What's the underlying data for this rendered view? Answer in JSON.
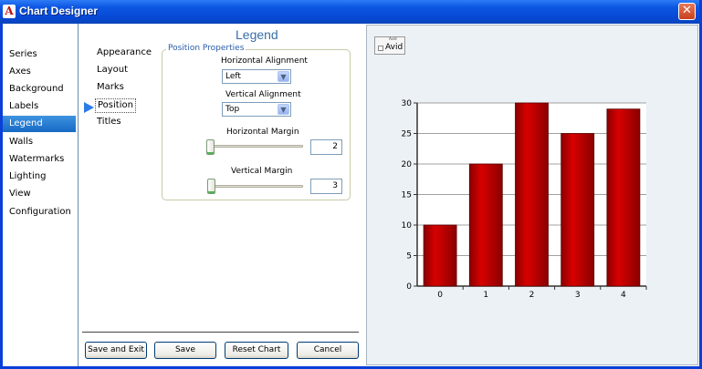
{
  "window": {
    "title": "Chart Designer",
    "app_icon_letter": "A",
    "close_glyph": "✕"
  },
  "left_nav": {
    "items": [
      {
        "label": "Series"
      },
      {
        "label": "Axes"
      },
      {
        "label": "Background"
      },
      {
        "label": "Labels"
      },
      {
        "label": "Legend",
        "active": true
      },
      {
        "label": "Walls"
      },
      {
        "label": "Watermarks"
      },
      {
        "label": "Lighting"
      },
      {
        "label": "View"
      },
      {
        "label": "Configuration"
      }
    ]
  },
  "sub_nav": {
    "items": [
      {
        "label": "Appearance"
      },
      {
        "label": "Layout"
      },
      {
        "label": "Marks"
      },
      {
        "label": "Position",
        "active": true
      },
      {
        "label": "Titles"
      }
    ]
  },
  "panel": {
    "heading": "Legend",
    "group_label": "Position Properties",
    "horizontal_alignment_label": "Horizontal Alignment",
    "horizontal_alignment_value": "Left",
    "vertical_alignment_label": "Vertical Alignment",
    "vertical_alignment_value": "Top",
    "horizontal_margin_label": "Horizontal Margin",
    "horizontal_margin_value": "2",
    "vertical_margin_label": "Vertical Margin",
    "vertical_margin_value": "3",
    "combo_arrow_glyph": "▼"
  },
  "buttons": {
    "save_and_exit": "Save and Exit",
    "save": "Save",
    "reset_chart": "Reset Chart",
    "cancel": "Cancel"
  },
  "legend_preview": {
    "title": "Avid",
    "entry": "Avid"
  },
  "colors": {
    "bar": "#d80000",
    "bar_dark": "#8a0000",
    "accent": "#1769c4"
  },
  "chart_data": {
    "type": "bar",
    "categories": [
      "0",
      "1",
      "2",
      "3",
      "4"
    ],
    "series": [
      {
        "name": "Avid",
        "values": [
          10,
          20,
          30,
          25,
          29
        ]
      }
    ],
    "ylim": [
      0,
      30
    ],
    "yticks": [
      0,
      5,
      10,
      15,
      20,
      25,
      30
    ],
    "grid": true,
    "legend_position": "top-left"
  }
}
